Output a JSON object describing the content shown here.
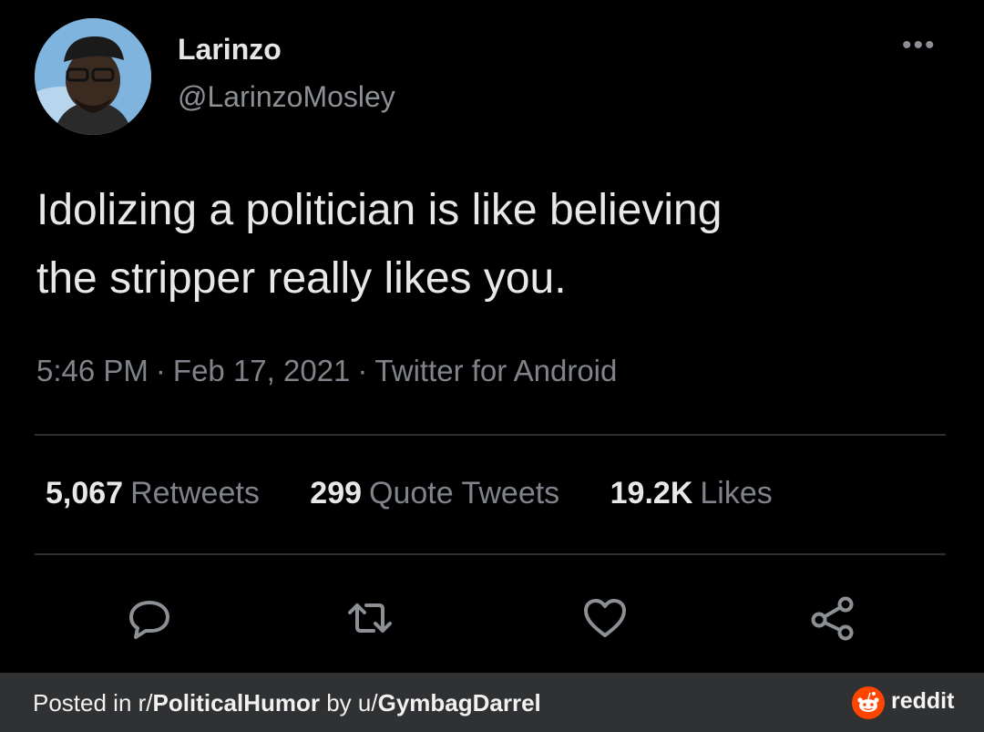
{
  "user": {
    "display_name": "Larinzo",
    "handle": "@LarinzoMosley"
  },
  "tweet": {
    "text_line1": "Idolizing a politician is like believing",
    "text_line2": "the stripper really likes you.",
    "time": "5:46 PM",
    "date": "Feb 17, 2021",
    "source": "Twitter for Android",
    "separator": "·"
  },
  "stats": {
    "retweets_count": "5,067",
    "retweets_label": "Retweets",
    "quotes_count": "299",
    "quotes_label": "Quote Tweets",
    "likes_count": "19.2K",
    "likes_label": "Likes"
  },
  "more_menu": "•••",
  "actions": [
    "reply-icon",
    "retweet-icon",
    "like-icon",
    "share-icon"
  ],
  "footer": {
    "posted_prefix": "Posted in r/",
    "subreddit": "PoliticalHumor",
    "by_text": " by u/",
    "username": "GymbagDarrel",
    "brand": "reddit"
  },
  "colors": {
    "background": "#000000",
    "footer_bg": "#303133",
    "reddit_orange": "#ff4500",
    "muted_text": "#80838a",
    "avatar_bg": "#7fb4de"
  }
}
